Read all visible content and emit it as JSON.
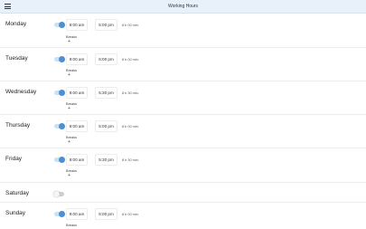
{
  "header": {
    "title": "Working Hours",
    "menu_icon": "hamburger-menu-icon"
  },
  "breaks_label": "Breaks",
  "add_symbol": "+",
  "days": [
    {
      "name": "Monday",
      "enabled": true,
      "start": "9:00 am",
      "end": "5:00 pm",
      "duration": "8 h 00 min."
    },
    {
      "name": "Tuesday",
      "enabled": true,
      "start": "9:00 am",
      "end": "6:00 pm",
      "duration": "8 h 00 min."
    },
    {
      "name": "Wednesday",
      "enabled": true,
      "start": "9:00 am",
      "end": "5:30 pm",
      "duration": "8 h 30 min."
    },
    {
      "name": "Thursday",
      "enabled": true,
      "start": "9:00 am",
      "end": "5:00 pm",
      "duration": "8 h 00 min."
    },
    {
      "name": "Friday",
      "enabled": true,
      "start": "9:00 am",
      "end": "5:30 pm",
      "duration": "8 h 30 min."
    },
    {
      "name": "Saturday",
      "enabled": false
    },
    {
      "name": "Sunday",
      "enabled": true,
      "start": "9:00 am",
      "end": "5:00 pm",
      "duration": "8 h 00 min."
    }
  ],
  "colors": {
    "accent": "#4a90d6",
    "appbar": "#e8f1f9"
  }
}
